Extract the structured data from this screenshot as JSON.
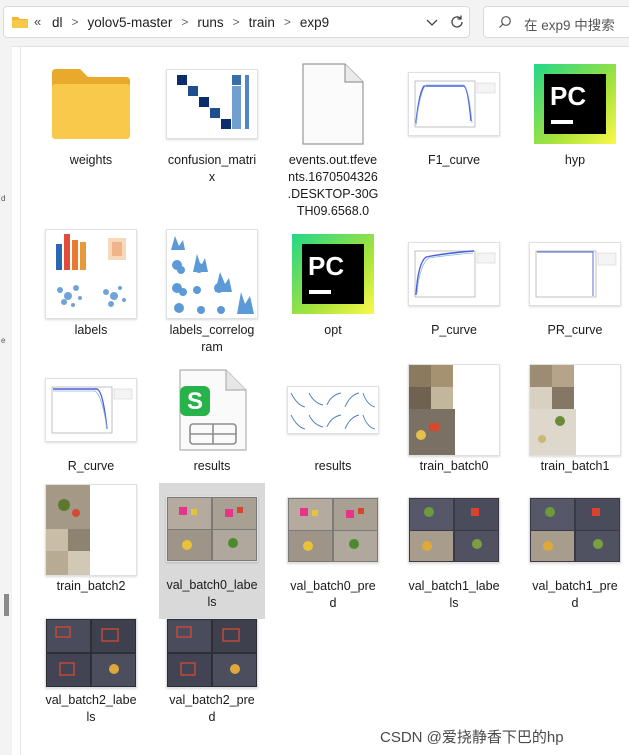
{
  "address_bar": {
    "back_chevron": "«",
    "breadcrumb": [
      "dl",
      "yolov5-master",
      "runs",
      "train",
      "exp9"
    ],
    "separator": ">"
  },
  "search": {
    "placeholder": "在 exp9 中搜索"
  },
  "sidebar_marks": [
    "d",
    "e"
  ],
  "files": [
    {
      "name": "weights",
      "type": "folder"
    },
    {
      "name": "confusion_matrix",
      "type": "image",
      "wrapped": "confusion_matri\nx"
    },
    {
      "name": "events.out.tfevents.1670504326.DESKTOP-30GTH09.6568.0",
      "type": "file",
      "wrapped": "events.out.tfeve\nnts.1670504326\n.DESKTOP-30G\nTH09.6568.0"
    },
    {
      "name": "F1_curve",
      "type": "image"
    },
    {
      "name": "hyp",
      "type": "pycharm"
    },
    {
      "name": "labels",
      "type": "image"
    },
    {
      "name": "labels_correlogram",
      "type": "image",
      "wrapped": "labels_correlog\nram"
    },
    {
      "name": "opt",
      "type": "pycharm"
    },
    {
      "name": "P_curve",
      "type": "image"
    },
    {
      "name": "PR_curve",
      "type": "image"
    },
    {
      "name": "R_curve",
      "type": "image"
    },
    {
      "name": "results",
      "type": "spreadsheet"
    },
    {
      "name": "results",
      "type": "image"
    },
    {
      "name": "train_batch0",
      "type": "image"
    },
    {
      "name": "train_batch1",
      "type": "image"
    },
    {
      "name": "train_batch2",
      "type": "image"
    },
    {
      "name": "val_batch0_labels",
      "type": "image",
      "wrapped": "val_batch0_labe\nls",
      "selected": true
    },
    {
      "name": "val_batch0_pred",
      "type": "image",
      "wrapped": "val_batch0_pre\nd"
    },
    {
      "name": "val_batch1_labels",
      "type": "image",
      "wrapped": "val_batch1_labe\nls"
    },
    {
      "name": "val_batch1_pred",
      "type": "image",
      "wrapped": "val_batch1_pre\nd"
    },
    {
      "name": "val_batch2_labels",
      "type": "image",
      "wrapped": "val_batch2_labe\nls"
    },
    {
      "name": "val_batch2_pred",
      "type": "image",
      "wrapped": "val_batch2_pre\nd"
    }
  ],
  "watermark": "CSDN @爱挠静香下巴的hp",
  "colors": {
    "selection": "#d9d9d9",
    "folder": "#f6c244",
    "pycharm_green": "#21d789"
  }
}
